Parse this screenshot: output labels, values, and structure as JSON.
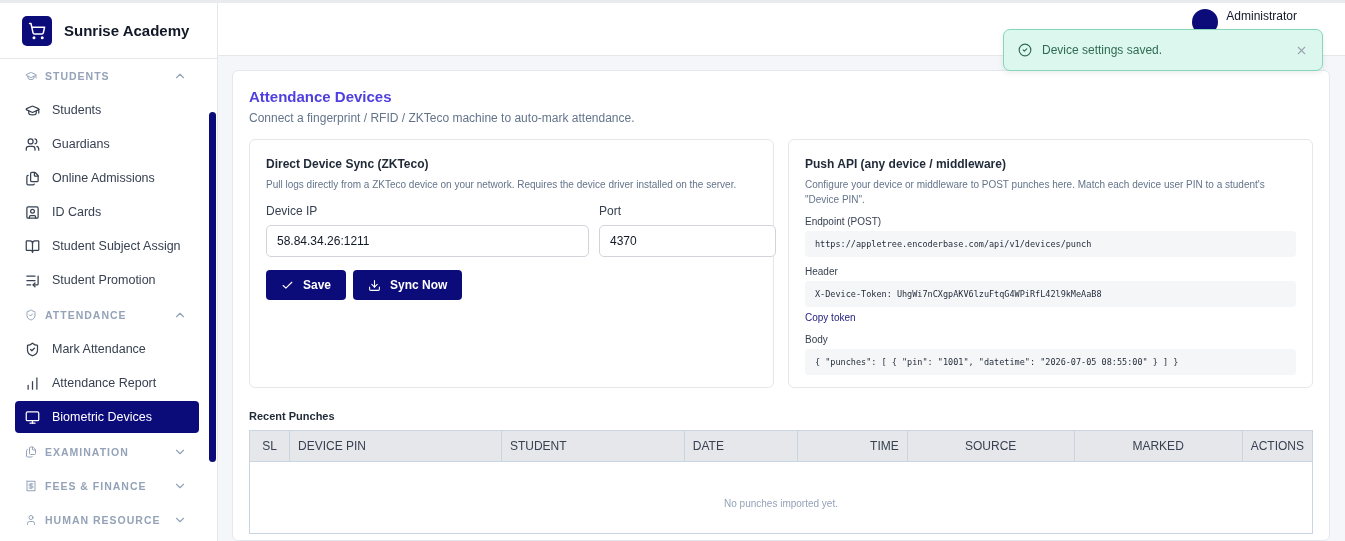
{
  "brand": {
    "name": "Sunrise Academy"
  },
  "sidebar": {
    "sections": [
      {
        "label": "STUDENTS",
        "expanded": true,
        "items": [
          {
            "label": "Students",
            "selected": false
          },
          {
            "label": "Guardians",
            "selected": false
          },
          {
            "label": "Online Admissions",
            "selected": false
          },
          {
            "label": "ID Cards",
            "selected": false
          },
          {
            "label": "Student Subject Assign",
            "selected": false
          },
          {
            "label": "Student Promotion",
            "selected": false
          }
        ]
      },
      {
        "label": "ATTENDANCE",
        "expanded": true,
        "items": [
          {
            "label": "Mark Attendance",
            "selected": false
          },
          {
            "label": "Attendance Report",
            "selected": false
          },
          {
            "label": "Biometric Devices",
            "selected": true
          }
        ]
      },
      {
        "label": "EXAMINATION",
        "expanded": false
      },
      {
        "label": "FEES & FINANCE",
        "expanded": false
      },
      {
        "label": "HUMAN RESOURCE",
        "expanded": false
      }
    ]
  },
  "header": {
    "user": "Administrator"
  },
  "toast": {
    "message": "Device settings saved."
  },
  "page": {
    "title": "Attendance Devices",
    "subtitle": "Connect a fingerprint / RFID / ZKTeco machine to auto-mark attendance."
  },
  "direct_sync": {
    "title": "Direct Device Sync (ZKTeco)",
    "description": "Pull logs directly from a ZKTeco device on your network. Requires the device driver installed on the server.",
    "fields": [
      {
        "label": "Device IP",
        "value": "58.84.34.26:1211"
      },
      {
        "label": "Port",
        "value": "4370"
      }
    ],
    "buttons": [
      {
        "label": "Save"
      },
      {
        "label": "Sync Now"
      }
    ]
  },
  "push_api": {
    "title": "Push API (any device / middleware)",
    "description": "Configure your device or middleware to POST punches here. Match each device user PIN to a student's \"Device PIN\".",
    "endpoint_label": "Endpoint (POST)",
    "endpoint": "https://appletree.encoderbase.com/api/v1/devices/punch",
    "header_label": "Header",
    "header": "X-Device-Token: UhgWi7nCXgpAKV6lzuFtqG4WPiRfL42l9kMeAaB8",
    "copy_link": "Copy token",
    "body_label": "Body",
    "body": "{ \"punches\": [ { \"pin\": \"1001\", \"datetime\": \"2026-07-05 08:55:00\" } ] }"
  },
  "recent": {
    "title": "Recent Punches",
    "columns": [
      "SL",
      "DEVICE PIN",
      "STUDENT",
      "DATE",
      "TIME",
      "SOURCE",
      "MARKED",
      "ACTIONS"
    ],
    "empty": "No punches imported yet."
  }
}
